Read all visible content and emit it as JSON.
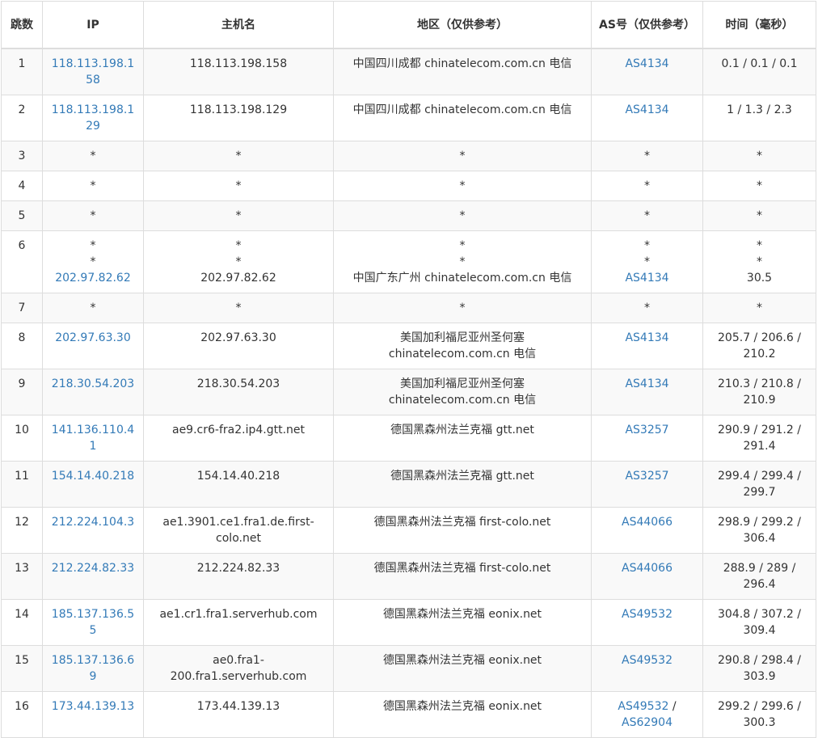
{
  "columns": {
    "hop": "跳数",
    "ip": "IP",
    "hostname": "主机名",
    "region": "地区（仅供参考）",
    "as": "AS号（仅供参考）",
    "time": "时间（毫秒）"
  },
  "rows": [
    {
      "hop": "1",
      "ip": "118.113.198.158",
      "host": "118.113.198.158",
      "region": "中国四川成都 chinatelecom.com.cn 电信",
      "as": "AS4134",
      "time": "0.1 / 0.1 / 0.1"
    },
    {
      "hop": "2",
      "ip": "118.113.198.129",
      "host": "118.113.198.129",
      "region": "中国四川成都 chinatelecom.com.cn 电信",
      "as": "AS4134",
      "time": "1 / 1.3 / 2.3"
    },
    {
      "hop": "3",
      "ip": "*",
      "host": "*",
      "region": "*",
      "as": "*",
      "time": "*"
    },
    {
      "hop": "4",
      "ip": "*",
      "host": "*",
      "region": "*",
      "as": "*",
      "time": "*"
    },
    {
      "hop": "5",
      "ip": "*",
      "host": "*",
      "region": "*",
      "as": "*",
      "time": "*"
    },
    {
      "hop": "6",
      "ip": [
        "*",
        "*",
        "202.97.82.62"
      ],
      "host": [
        "*",
        "*",
        "202.97.82.62"
      ],
      "region": [
        "*",
        "*",
        "中国广东广州 chinatelecom.com.cn 电信"
      ],
      "as": [
        "*",
        "*",
        "AS4134"
      ],
      "time": [
        "*",
        "*",
        "30.5"
      ]
    },
    {
      "hop": "7",
      "ip": "*",
      "host": "*",
      "region": "*",
      "as": "*",
      "time": "*"
    },
    {
      "hop": "8",
      "ip": "202.97.63.30",
      "host": "202.97.63.30",
      "region": "美国加利福尼亚州圣何塞 chinatelecom.com.cn 电信",
      "as": "AS4134",
      "time": "205.7 / 206.6 / 210.2"
    },
    {
      "hop": "9",
      "ip": "218.30.54.203",
      "host": "218.30.54.203",
      "region": "美国加利福尼亚州圣何塞 chinatelecom.com.cn 电信",
      "as": "AS4134",
      "time": "210.3 / 210.8 / 210.9"
    },
    {
      "hop": "10",
      "ip": "141.136.110.41",
      "host": "ae9.cr6-fra2.ip4.gtt.net",
      "region": "德国黑森州法兰克福 gtt.net",
      "as": "AS3257",
      "time": "290.9 / 291.2 / 291.4"
    },
    {
      "hop": "11",
      "ip": "154.14.40.218",
      "host": "154.14.40.218",
      "region": "德国黑森州法兰克福 gtt.net",
      "as": "AS3257",
      "time": "299.4 / 299.4 / 299.7"
    },
    {
      "hop": "12",
      "ip": "212.224.104.3",
      "host": "ae1.3901.ce1.fra1.de.first-colo.net",
      "region": "德国黑森州法兰克福 first-colo.net",
      "as": "AS44066",
      "time": "298.9 / 299.2 / 306.4"
    },
    {
      "hop": "13",
      "ip": "212.224.82.33",
      "host": "212.224.82.33",
      "region": "德国黑森州法兰克福 first-colo.net",
      "as": "AS44066",
      "time": "288.9 / 289 / 296.4"
    },
    {
      "hop": "14",
      "ip": "185.137.136.55",
      "host": "ae1.cr1.fra1.serverhub.com",
      "region": "德国黑森州法兰克福 eonix.net",
      "as": "AS49532",
      "time": "304.8 / 307.2 / 309.4"
    },
    {
      "hop": "15",
      "ip": "185.137.136.69",
      "host": "ae0.fra1-200.fra1.serverhub.com",
      "region": "德国黑森州法兰克福 eonix.net",
      "as": "AS49532",
      "time": "290.8 / 298.4 / 303.9"
    },
    {
      "hop": "16",
      "ip": "173.44.139.13",
      "host": "173.44.139.13",
      "region": "德国黑森州法兰克福 eonix.net",
      "as": [
        "AS49532",
        "AS62904"
      ],
      "time": "299.2 / 299.6 / 300.3"
    }
  ],
  "colors": {
    "link": "#337ab7",
    "text": "#333333",
    "border": "#dddddd",
    "stripe": "#f9f9f9"
  }
}
